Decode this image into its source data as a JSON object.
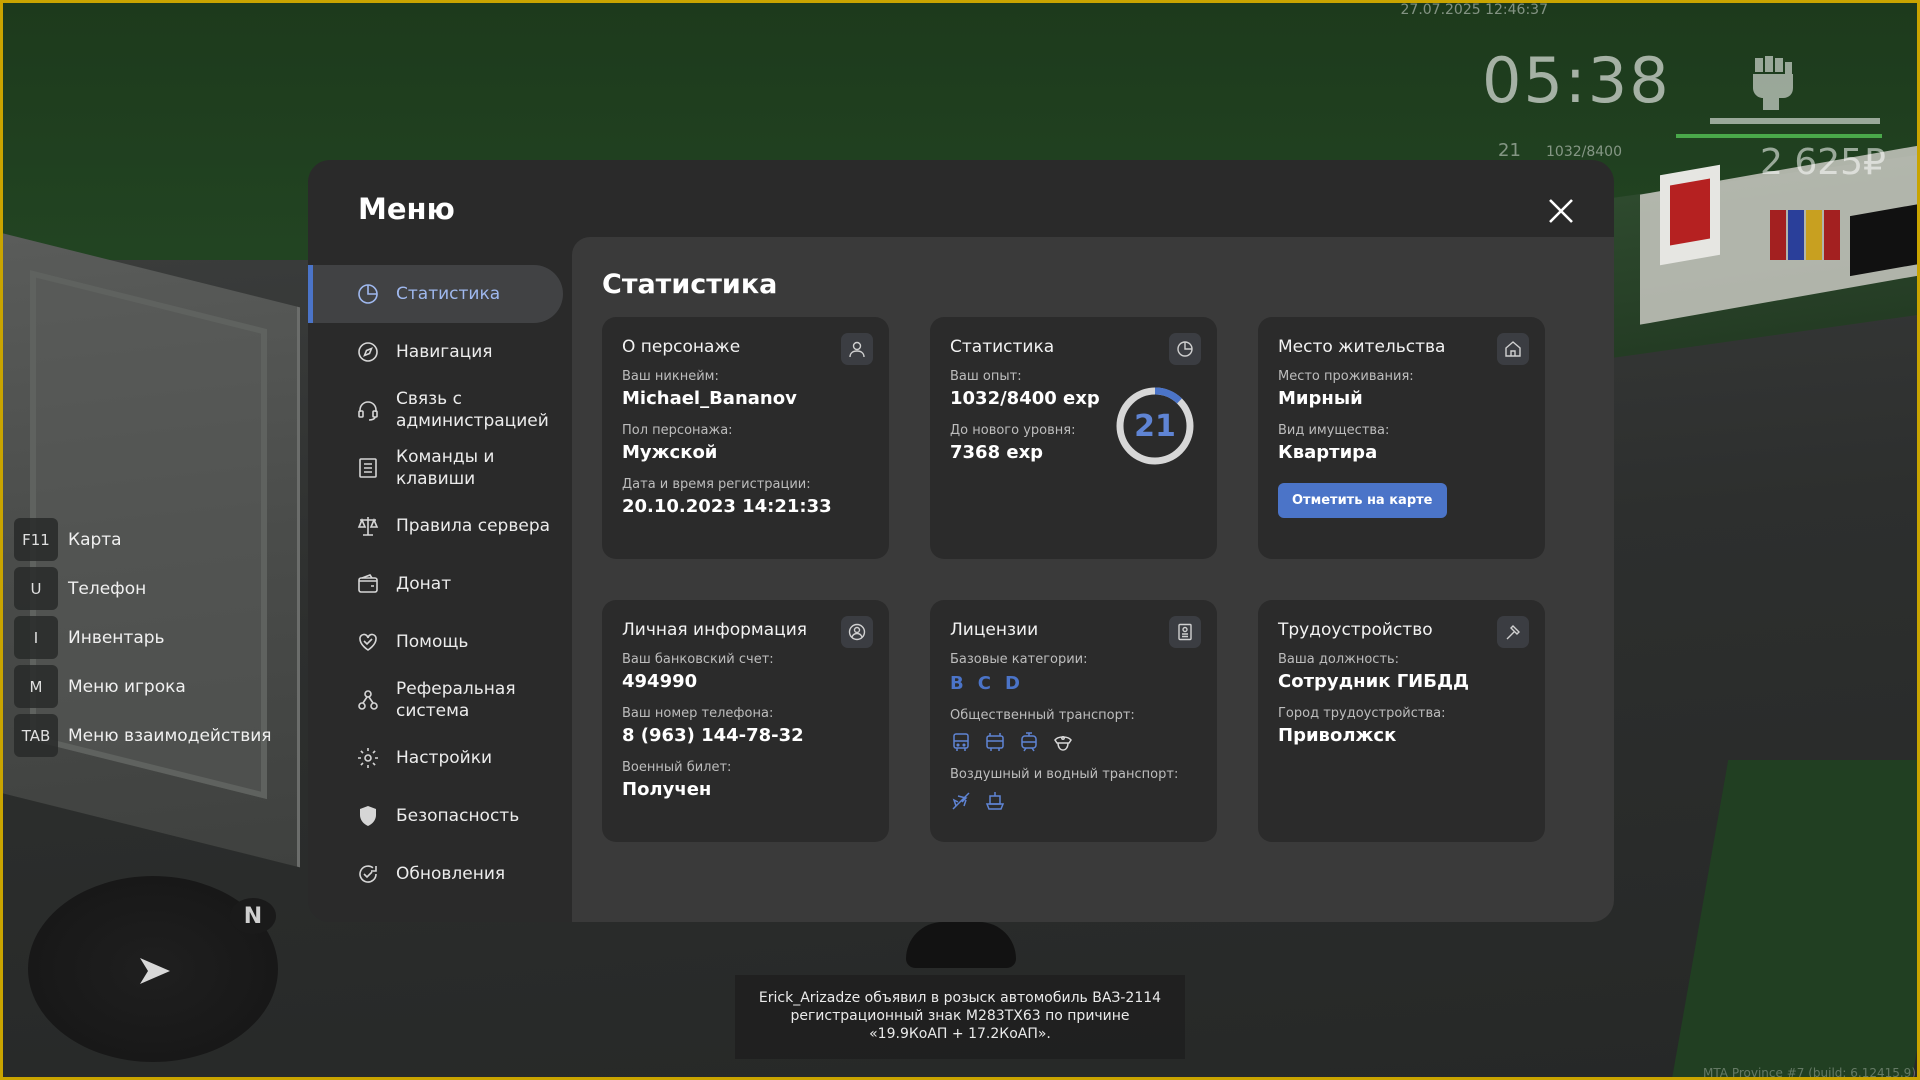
{
  "hud": {
    "datetime": "27.07.2025 12:46:37",
    "clock": "05:38",
    "level": "21",
    "exp": "1032/8400",
    "money": "2 625₽",
    "health_fraction": 0.83,
    "armor_fraction": 1.0,
    "colors": {
      "armor": "#4aa84a"
    }
  },
  "hotkeys": [
    {
      "key": "F11",
      "label": "Карта"
    },
    {
      "key": "U",
      "label": "Телефон"
    },
    {
      "key": "I",
      "label": "Инвентарь"
    },
    {
      "key": "M",
      "label": "Меню игрока"
    },
    {
      "key": "TAB",
      "label": "Меню взаимодействия"
    }
  ],
  "minimap": {
    "north": "N"
  },
  "menu": {
    "title": "Меню",
    "accent": "#4b74c8",
    "sidebar": [
      {
        "label": "Статистика",
        "icon": "pie-chart-icon",
        "active": true
      },
      {
        "label": "Навигация",
        "icon": "compass-icon"
      },
      {
        "label": "Связь с\nадминистрацией",
        "icon": "headset-icon"
      },
      {
        "label": "Команды и\nклавиши",
        "icon": "list-icon"
      },
      {
        "label": "Правила сервера",
        "icon": "scales-icon"
      },
      {
        "label": "Донат",
        "icon": "wallet-icon"
      },
      {
        "label": "Помощь",
        "icon": "handshake-icon"
      },
      {
        "label": "Реферальная\nсистема",
        "icon": "referral-icon"
      },
      {
        "label": "Настройки",
        "icon": "gear-icon"
      },
      {
        "label": "Безопасность",
        "icon": "shield-icon"
      },
      {
        "label": "Обновления",
        "icon": "refresh-icon"
      }
    ],
    "content_title": "Статистика",
    "cards": {
      "character": {
        "title": "О персонаже",
        "nick_label": "Ваш никнейм:",
        "nick": "Michael_Bananov",
        "gender_label": "Пол персонажа:",
        "gender": "Мужской",
        "reg_label": "Дата и время регистрации:",
        "reg": "20.10.2023 14:21:33"
      },
      "stats": {
        "title": "Статистика",
        "exp_label": "Ваш опыт:",
        "exp": "1032/8400 exp",
        "next_label": "До нового уровня:",
        "next": "7368 exp",
        "level": "21",
        "progress": 0.1229
      },
      "residence": {
        "title": "Место жительства",
        "place_label": "Место проживания:",
        "place": "Мирный",
        "type_label": "Вид имущества:",
        "type": "Квартира",
        "button": "Отметить на карте"
      },
      "personal": {
        "title": "Личная информация",
        "bank_label": "Ваш банковский счет:",
        "bank": "494990",
        "phone_label": "Ваш номер телефона:",
        "phone": "8 (963) 144-78-32",
        "military_label": "Военный билет:",
        "military": "Получен"
      },
      "licenses": {
        "title": "Лицензии",
        "base_label": "Базовые категории:",
        "categories": [
          "B",
          "C",
          "D"
        ],
        "public_label": "Общественный транспорт:",
        "public_icons": [
          "bus-icon",
          "trolleybus-icon",
          "tram-icon",
          "driver-cap-icon"
        ],
        "air_label": "Воздушный и водный транспорт:",
        "air_icons": [
          "plane-icon",
          "boat-icon"
        ]
      },
      "job": {
        "title": "Трудоустройство",
        "position_label": "Ваша должность:",
        "position": "Сотрудник ГИБДД",
        "city_label": "Город трудоустройства:",
        "city": "Приволжск"
      }
    }
  },
  "notification": "Erick_Arizadze объявил в розыск автомобиль ВАЗ-2114 регистрационный знак М283ТХ63 по причине «19.9КоАП + 17.2КоАП».",
  "build": "MTA Province #7 (build: 6.12415.9)"
}
